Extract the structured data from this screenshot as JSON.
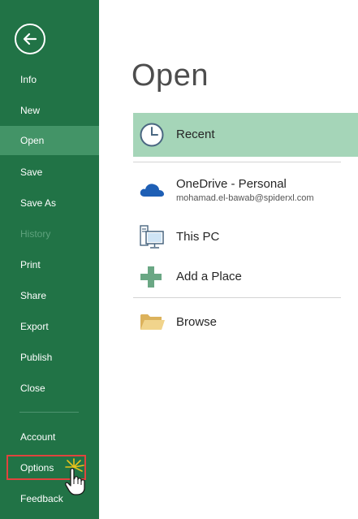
{
  "sidebar": {
    "items": [
      {
        "key": "info",
        "label": "Info",
        "active": false,
        "disabled": false
      },
      {
        "key": "new",
        "label": "New",
        "active": false,
        "disabled": false
      },
      {
        "key": "open",
        "label": "Open",
        "active": true,
        "disabled": false
      },
      {
        "key": "save",
        "label": "Save",
        "active": false,
        "disabled": false
      },
      {
        "key": "save-as",
        "label": "Save As",
        "active": false,
        "disabled": false
      },
      {
        "key": "history",
        "label": "History",
        "active": false,
        "disabled": true
      },
      {
        "key": "print",
        "label": "Print",
        "active": false,
        "disabled": false
      },
      {
        "key": "share",
        "label": "Share",
        "active": false,
        "disabled": false
      },
      {
        "key": "export",
        "label": "Export",
        "active": false,
        "disabled": false
      },
      {
        "key": "publish",
        "label": "Publish",
        "active": false,
        "disabled": false
      },
      {
        "key": "close",
        "label": "Close",
        "active": false,
        "disabled": false
      }
    ],
    "bottom_items": [
      {
        "key": "account",
        "label": "Account"
      },
      {
        "key": "options",
        "label": "Options"
      },
      {
        "key": "feedback",
        "label": "Feedback"
      }
    ]
  },
  "main": {
    "title": "Open",
    "locations": {
      "recent": {
        "label": "Recent",
        "icon": "clock-icon"
      },
      "onedrive": {
        "label": "OneDrive - Personal",
        "sublabel": "mohamad.el-bawab@spiderxl.com",
        "icon": "cloud-icon"
      },
      "thispc": {
        "label": "This PC",
        "icon": "computer-icon"
      },
      "addplace": {
        "label": "Add a Place",
        "icon": "plus-icon"
      },
      "browse": {
        "label": "Browse",
        "icon": "folder-icon"
      }
    }
  },
  "colors": {
    "sidebar_bg": "#217346",
    "sidebar_active": "#439467",
    "recent_highlight": "#a5d5b8",
    "highlight_box": "#e0443e"
  }
}
